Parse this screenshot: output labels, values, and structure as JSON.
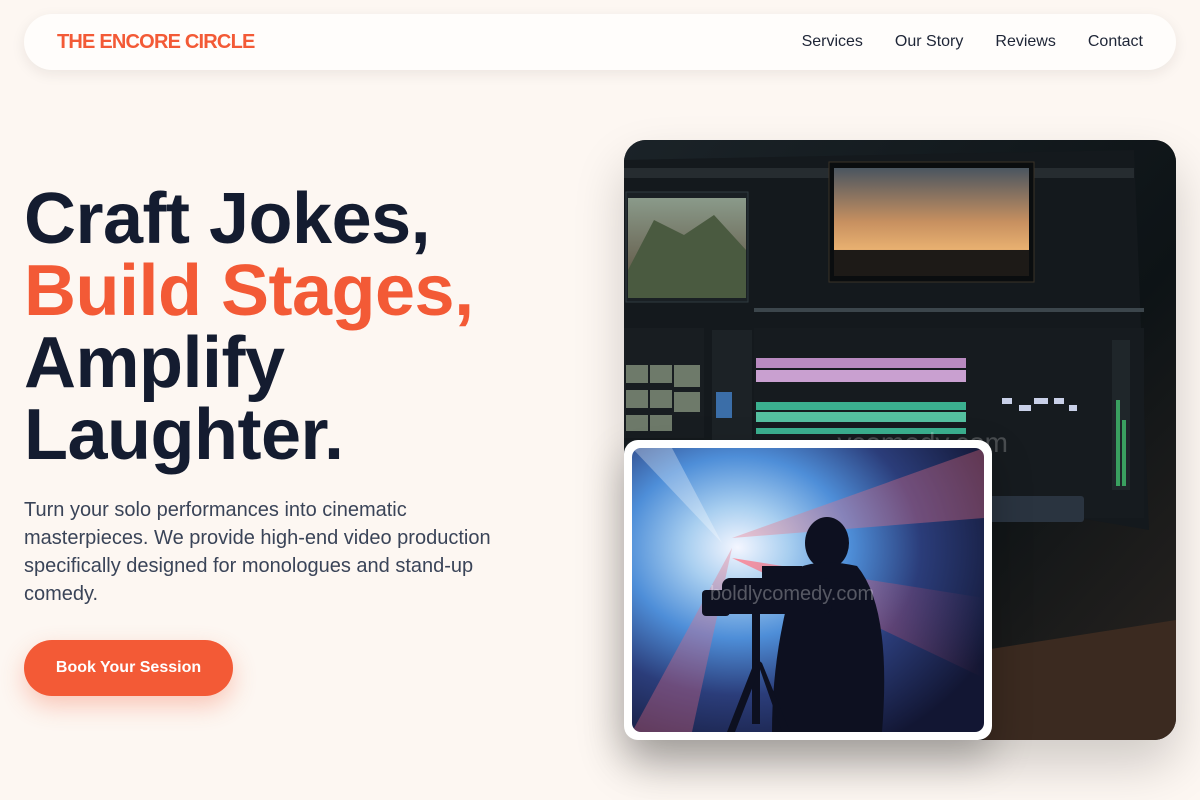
{
  "nav": {
    "brand": "THE ENCORE CIRCLE",
    "links": [
      "Services",
      "Our Story",
      "Reviews",
      "Contact"
    ]
  },
  "hero": {
    "headline": {
      "line1": "Craft Jokes,",
      "line2": "Build Stages,",
      "line3": "Amplify",
      "line4": "Laughter."
    },
    "lead": "Turn your solo performances into cinematic masterpieces. We provide high-end video production specifically designed for monologues and stand-up comedy.",
    "cta_label": "Book Your Session"
  },
  "images": {
    "main_watermark": "...ycomedy.com",
    "inset_watermark": "boldlycomedy.com"
  },
  "colors": {
    "accent": "#f35a36",
    "heading": "#141c30",
    "background": "#fdf7f2"
  }
}
